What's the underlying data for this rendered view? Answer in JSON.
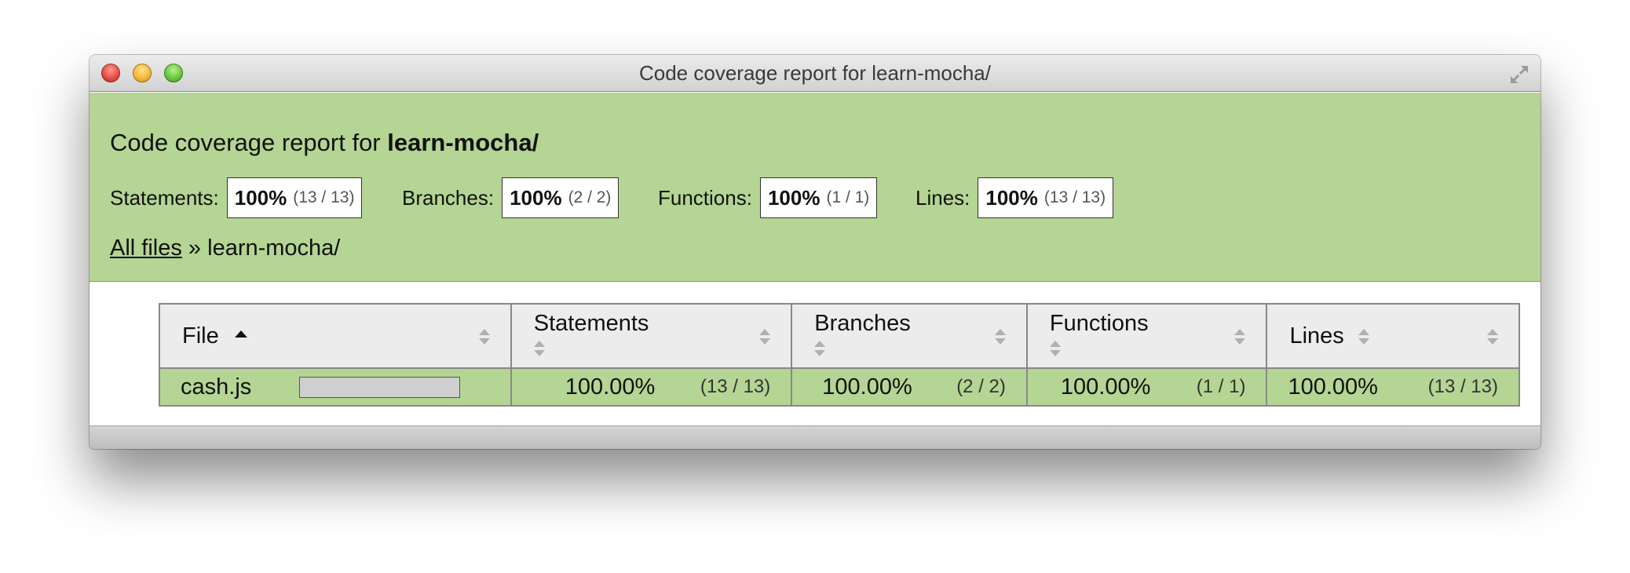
{
  "window": {
    "title": "Code coverage report for learn-mocha/",
    "controls": [
      "close-icon",
      "minimize-icon",
      "zoom-icon",
      "fullscreen-icon"
    ]
  },
  "header": {
    "title_prefix": "Code coverage report for",
    "title_bold": "learn-mocha/",
    "stats": [
      {
        "label": "Statements:",
        "pct": "100%",
        "frac": "(13 / 13)"
      },
      {
        "label": "Branches:",
        "pct": "100%",
        "frac": "(2 / 2)"
      },
      {
        "label": "Functions:",
        "pct": "100%",
        "frac": "(1 / 1)"
      },
      {
        "label": "Lines:",
        "pct": "100%",
        "frac": "(13 / 13)"
      }
    ],
    "breadcrumb": {
      "link": "All files",
      "separator": "»",
      "current": "learn-mocha/"
    }
  },
  "table": {
    "columns": [
      "File",
      "Statements",
      "Branches",
      "Functions",
      "Lines"
    ],
    "rows": [
      {
        "file": "cash.js",
        "coverage_fraction": 1.0,
        "statements_pct": "100.00%",
        "statements_frac": "(13 / 13)",
        "branches_pct": "100.00%",
        "branches_frac": "(2 / 2)",
        "functions_pct": "100.00%",
        "functions_frac": "(1 / 1)",
        "lines_pct": "100.00%",
        "lines_frac": "(13 / 13)"
      }
    ]
  },
  "colors": {
    "high_coverage_bg": "#b4d593",
    "header_bg": "#ececec"
  }
}
